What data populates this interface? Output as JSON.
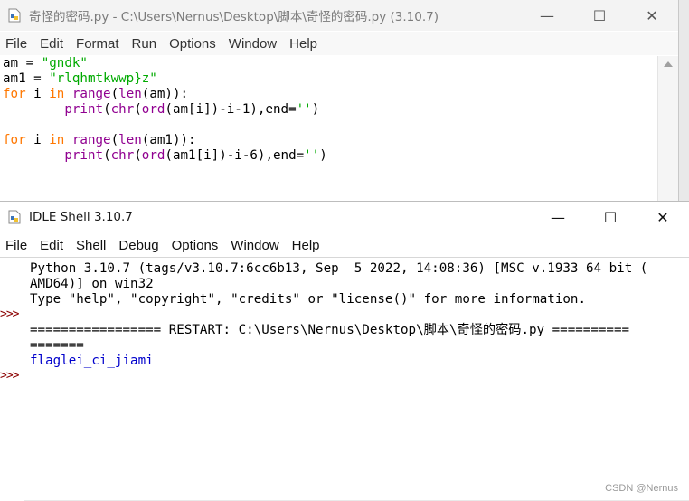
{
  "editor": {
    "title": "奇怪的密码.py - C:\\Users\\Nernus\\Desktop\\脚本\\奇怪的密码.py (3.10.7)",
    "menu": [
      "File",
      "Edit",
      "Format",
      "Run",
      "Options",
      "Window",
      "Help"
    ],
    "controls": {
      "minimize": "—",
      "maximize": "☐",
      "close": "✕"
    },
    "code": {
      "l1_var": "am = ",
      "l1_str": "\"gndk\"",
      "l2_var": "am1 = ",
      "l2_str": "\"rlqhmtkwwp}z\"",
      "l3_for": "for",
      "l3_mid": " i ",
      "l3_in": "in",
      "l3_sp": " ",
      "l3_range": "range",
      "l3_p": "(",
      "l3_len": "len",
      "l3_rest": "(am)):",
      "l4_ind": "        ",
      "l4_print": "print",
      "l4_p": "(",
      "l4_chr": "chr",
      "l4_p2": "(",
      "l4_ord": "ord",
      "l4_rest": "(am[i])-i-1),end=",
      "l4_str": "''",
      "l4_end": ")",
      "l6_for": "for",
      "l6_mid": " i ",
      "l6_in": "in",
      "l6_sp": " ",
      "l6_range": "range",
      "l6_p": "(",
      "l6_len": "len",
      "l6_rest": "(am1)):",
      "l7_ind": "        ",
      "l7_print": "print",
      "l7_p": "(",
      "l7_chr": "chr",
      "l7_p2": "(",
      "l7_ord": "ord",
      "l7_rest": "(am1[i])-i-6),end=",
      "l7_str": "''",
      "l7_end": ")"
    }
  },
  "shell": {
    "title": "IDLE Shell 3.10.7",
    "menu": [
      "File",
      "Edit",
      "Shell",
      "Debug",
      "Options",
      "Window",
      "Help"
    ],
    "controls": {
      "minimize": "—",
      "maximize": "☐",
      "close": "✕"
    },
    "prompt": ">>>",
    "lines": [
      "Python 3.10.7 (tags/v3.10.7:6cc6b13, Sep  5 2022, 14:08:36) [MSC v.1933 64 bit (",
      "AMD64)] on win32",
      "Type \"help\", \"copyright\", \"credits\" or \"license()\" for more information.",
      "",
      "================= RESTART: C:\\Users\\Nernus\\Desktop\\脚本\\奇怪的密码.py ==========",
      "=======",
      "flaglei_ci_jiami"
    ]
  },
  "watermark": "CSDN @Nernus",
  "colors": {
    "keyword": "#ff7700",
    "builtin": "#900090",
    "string": "#00aa00",
    "output": "#0000cc",
    "prompt": "#8b0000"
  },
  "icons": {
    "app": "python-file-icon"
  }
}
